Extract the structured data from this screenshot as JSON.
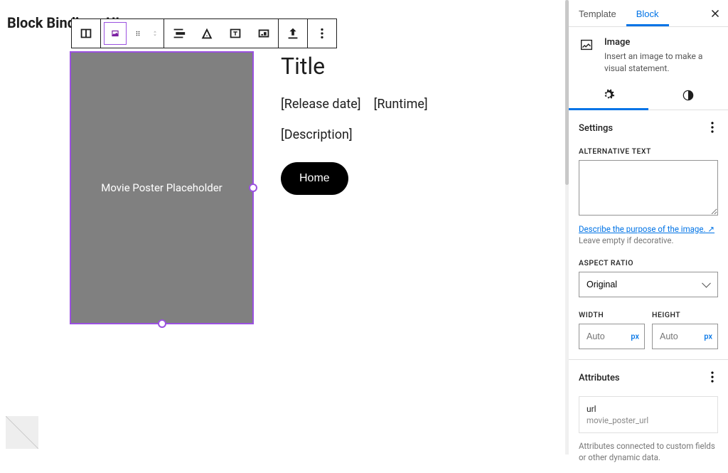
{
  "page": {
    "title": "Block Bindings UI"
  },
  "image_block": {
    "placeholder_text": "Movie Poster Placeholder"
  },
  "content": {
    "title": "Title",
    "release_date": "[Release date]",
    "runtime": "[Runtime]",
    "description": "[Description]",
    "home_label": "Home"
  },
  "sidebar": {
    "tabs": {
      "template": "Template",
      "block": "Block"
    },
    "block_desc": {
      "title": "Image",
      "sub": "Insert an image to make a visual statement."
    },
    "settings_panel": {
      "title": "Settings",
      "alt_label": "ALTERNATIVE TEXT",
      "alt_help_link": "Describe the purpose of the image.",
      "alt_help_muted": "Leave empty if decorative.",
      "aspect_label": "ASPECT RATIO",
      "aspect_value": "Original",
      "width_label": "WIDTH",
      "height_label": "HEIGHT",
      "width_placeholder": "Auto",
      "height_placeholder": "Auto",
      "unit": "px"
    },
    "attributes_panel": {
      "title": "Attributes",
      "key": "url",
      "value": "movie_poster_url",
      "help": "Attributes connected to custom fields or other dynamic data."
    }
  }
}
